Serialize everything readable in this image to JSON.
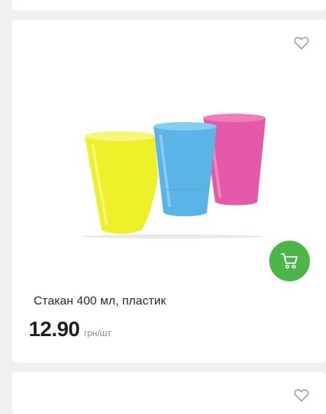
{
  "product": {
    "name": "Стакан 400 мл, пластик",
    "price": "12.90",
    "unit": "грн/шт",
    "image_subject": "three plastic cups: yellow, blue, pink"
  },
  "icons": {
    "favorite": "heart-outline-icon",
    "cart": "shopping-cart-icon"
  },
  "colors": {
    "accent": "#4cb749",
    "background": "#f0f0f1",
    "card": "#ffffff",
    "cup_yellow": "#eef02a",
    "cup_blue": "#5ab4e8",
    "cup_pink": "#e55aa8"
  }
}
